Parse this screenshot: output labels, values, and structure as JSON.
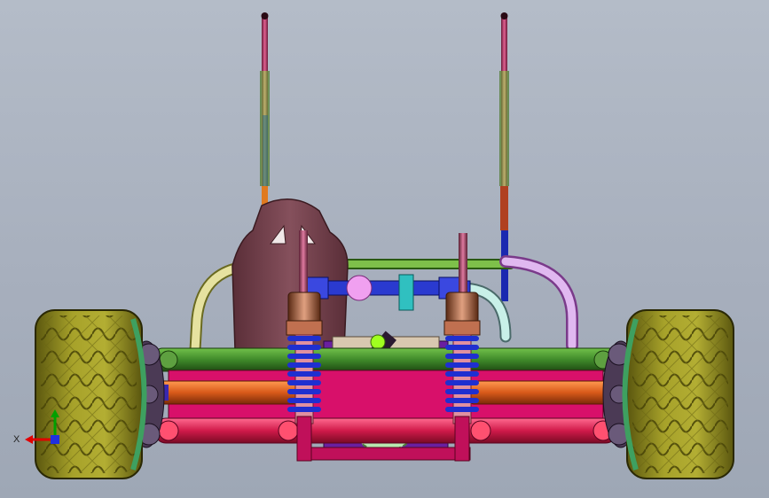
{
  "view": {
    "background_top": "#b4bcc8",
    "background_bottom": "#9ea7b5"
  },
  "model": {
    "subject": "rc-buggy-rear-view",
    "colors": {
      "tire": "#8f8a1c",
      "tire_dark": "#5e5a10",
      "hub": "#4b3a55",
      "seat": "#6e3a46",
      "spring": "#1f2fd0",
      "shock_body": "#b04080",
      "a_arm_upper": "#3f8a2a",
      "a_arm_lower": "#d01a4a",
      "axle": "#d85a1a",
      "gear": "#9fe0a0",
      "roll_bar": "#e6e2a0",
      "gearbox": "#6a1fa0",
      "chassis": "#d8c8b0"
    }
  },
  "triad": {
    "x_label": "X",
    "x_color": "#e00000",
    "y_color": "#00a000",
    "z_color": "#2030e0"
  }
}
